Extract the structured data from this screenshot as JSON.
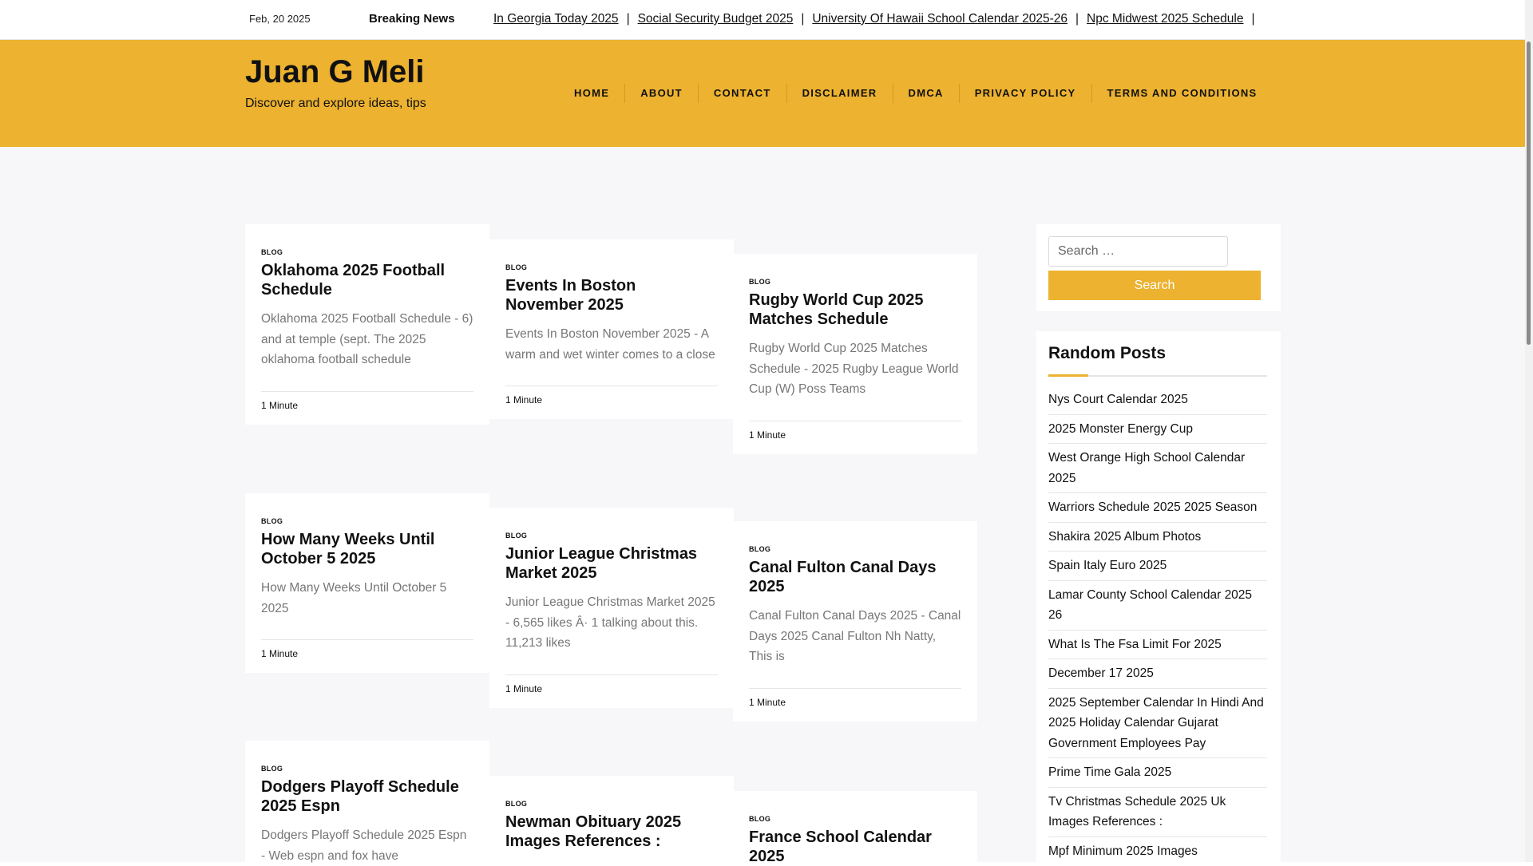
{
  "topbar": {
    "date": "Feb, 20 2025",
    "breaking_label": "Breaking News",
    "ticker": [
      "In Georgia Today 2025",
      "Social Security Budget 2025",
      "University Of Hawaii School Calendar 2025-26",
      "Npc Midwest 2025 Schedule"
    ],
    "separator": "|"
  },
  "header": {
    "site_title": "Juan G Meli",
    "site_description": "Discover and explore ideas, tips",
    "nav": [
      "HOME",
      "ABOUT",
      "CONTACT",
      "DISCLAIMER",
      "DMCA",
      "PRIVACY POLICY",
      "TERMS AND CONDITIONS"
    ],
    "accent_color": "#ecb230"
  },
  "posts": [
    {
      "category": "BLOG",
      "title": "Oklahoma 2025 Football Schedule",
      "excerpt": "Oklahoma 2025 Football Schedule - 6) and at temple (sept. The 2025 oklahoma football schedule",
      "read_time": "1 Minute"
    },
    {
      "category": "BLOG",
      "title": "Events In Boston November 2025",
      "excerpt": "Events In Boston November 2025 - A warm and wet winter comes to a close",
      "read_time": "1 Minute"
    },
    {
      "category": "BLOG",
      "title": "Rugby World Cup 2025 Matches Schedule",
      "excerpt": "Rugby World Cup 2025 Matches Schedule - 2025 Rugby League World Cup (W) Poss Teams",
      "read_time": "1 Minute"
    },
    {
      "category": "BLOG",
      "title": "How Many Weeks Until October 5 2025",
      "excerpt": "How Many Weeks Until October 5 2025",
      "read_time": "1 Minute"
    },
    {
      "category": "BLOG",
      "title": "Junior League Christmas Market 2025",
      "excerpt": "Junior League Christmas Market 2025 - 6,565 likes Â· 1 talking about this. 11,213 likes",
      "read_time": "1 Minute"
    },
    {
      "category": "BLOG",
      "title": "Canal Fulton Canal Days 2025",
      "excerpt": "Canal Fulton Canal Days 2025 - Canal Days 2025 Canal Fulton Nh Natty, This is",
      "read_time": "1 Minute"
    },
    {
      "category": "BLOG",
      "title": "Dodgers Playoff Schedule 2025 Espn",
      "excerpt": "Dodgers Playoff Schedule 2025 Espn - Web espn and fox have",
      "read_time": ""
    },
    {
      "category": "BLOG",
      "title": "Newman Obituary 2025 Images References :",
      "excerpt": "",
      "read_time": ""
    },
    {
      "category": "BLOG",
      "title": "France School Calendar 2025",
      "excerpt": "",
      "read_time": ""
    }
  ],
  "sidebar": {
    "search_placeholder": "Search …",
    "search_button": "Search",
    "random_title": "Random Posts",
    "random_posts": [
      "Nys Court Calendar 2025",
      "2025 Monster Energy Cup",
      "West Orange High School Calendar 2025",
      "Warriors Schedule 2025 2025 Season",
      "Shakira 2025 Album Photos",
      "Spain Italy Euro 2025",
      "Lamar County School Calendar 2025 26",
      "What Is The Fsa Limit For 2025",
      "December 17 2025",
      "2025 September Calendar In Hindi And 2025 Holiday Calendar Gujarat Government Employees Pay",
      "Prime Time Gala 2025",
      "Tv Christmas Schedule 2025 Uk Images References :",
      "Mpf Minimum 2025 Images"
    ]
  }
}
